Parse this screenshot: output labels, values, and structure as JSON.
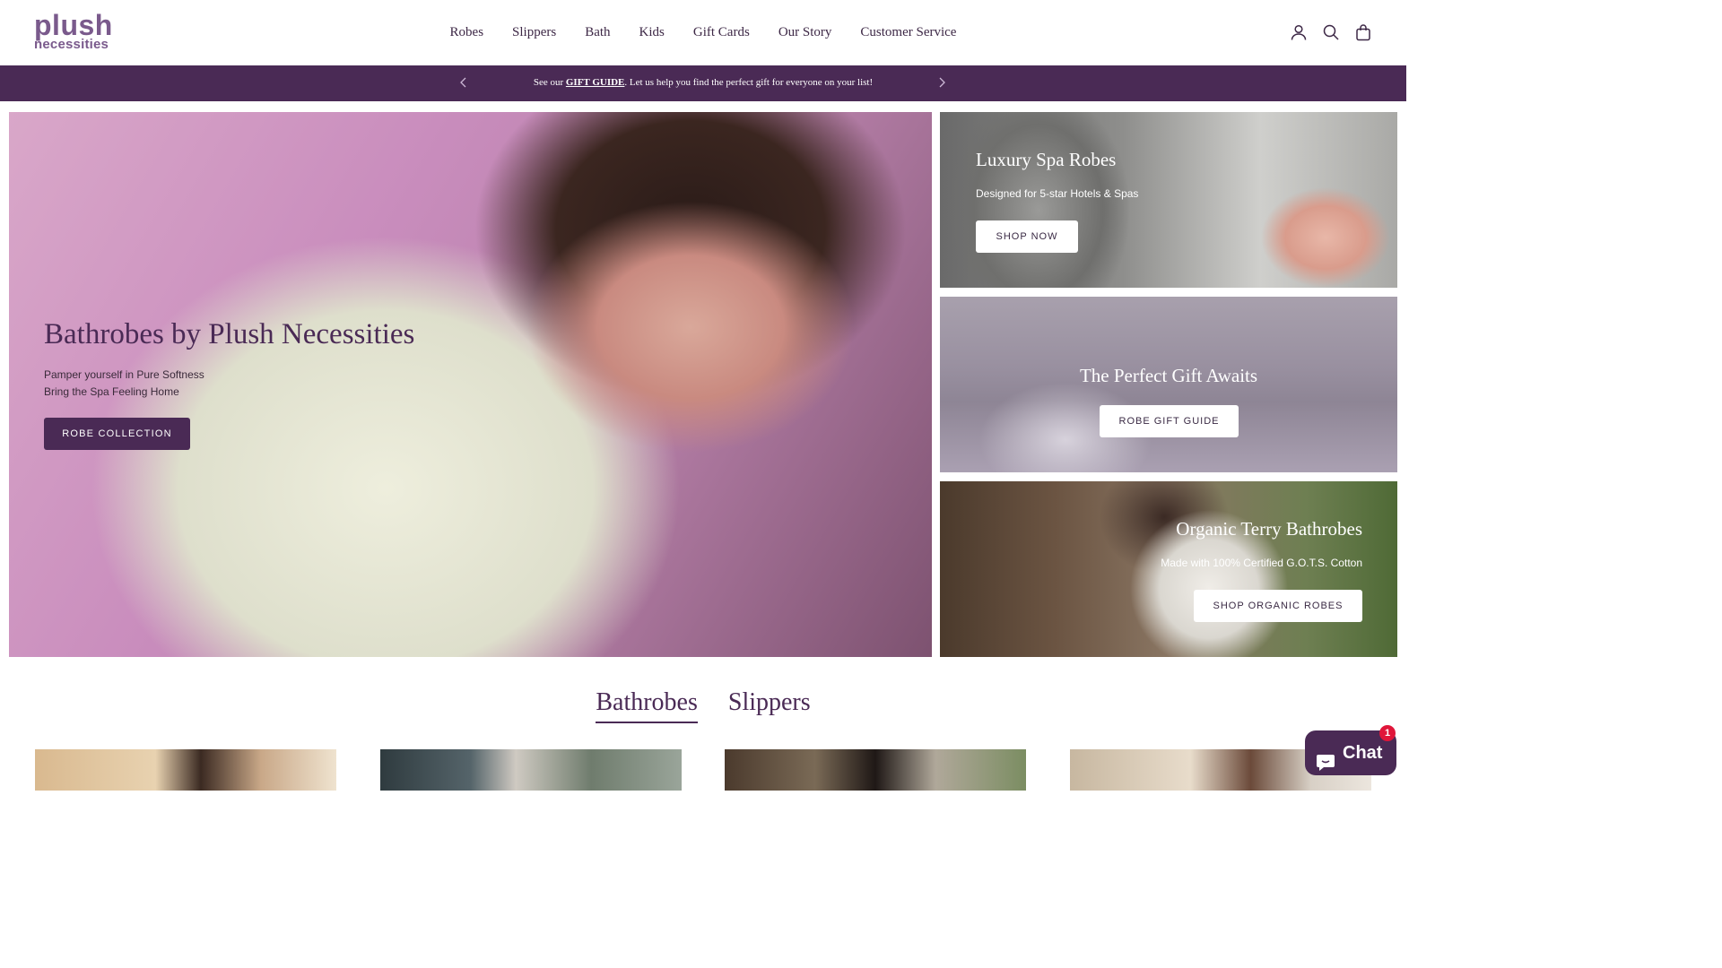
{
  "brand": {
    "line1": "plush",
    "line2": "necessities"
  },
  "nav": {
    "items": [
      "Robes",
      "Slippers",
      "Bath",
      "Kids",
      "Gift Cards",
      "Our Story",
      "Customer Service"
    ]
  },
  "header_icons": [
    "account-icon",
    "search-icon",
    "bag-icon"
  ],
  "announcement": {
    "prefix": "See our ",
    "link": "GIFT GUIDE",
    "suffix": ". Let us help you find the perfect gift for everyone on your list!"
  },
  "hero": {
    "title": "Bathrobes by Plush Necessities",
    "sub1": "Pamper yourself in Pure Softness",
    "sub2": "Bring the Spa Feeling Home",
    "button": "ROBE COLLECTION"
  },
  "tiles": [
    {
      "title": "Luxury Spa Robes",
      "sub": "Designed for 5-star Hotels & Spas",
      "button": "SHOP NOW"
    },
    {
      "title": "The Perfect Gift Awaits",
      "sub": "",
      "button": "ROBE GIFT GUIDE"
    },
    {
      "title": "Organic Terry Bathrobes",
      "sub": "Made with 100% Certified G.O.T.S. Cotton",
      "button": "SHOP ORGANIC ROBES"
    }
  ],
  "tabs": {
    "items": [
      "Bathrobes",
      "Slippers"
    ],
    "active": "Bathrobes"
  },
  "chat": {
    "label": "Chat",
    "badge": "1"
  },
  "colors": {
    "brand_purple": "#4a2a55",
    "logo_purple": "#7a5a8c",
    "badge_red": "#e0163a"
  }
}
